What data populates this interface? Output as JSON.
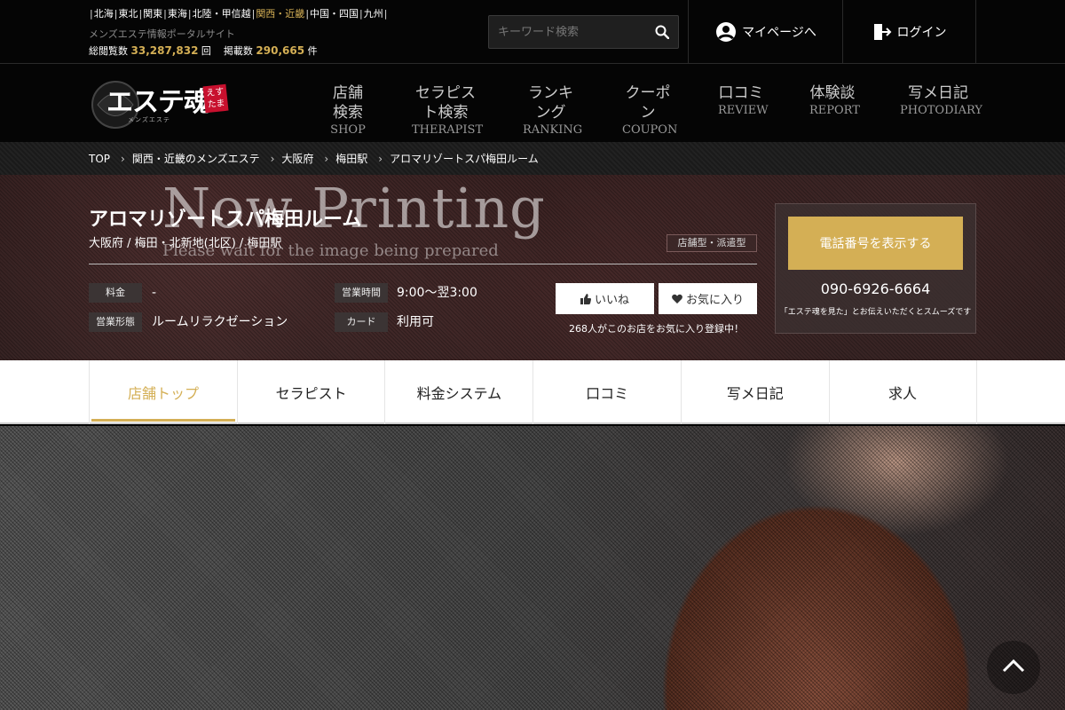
{
  "top": {
    "areas": [
      {
        "label": "北海",
        "active": false
      },
      {
        "label": "東北",
        "active": false
      },
      {
        "label": "関東",
        "active": false
      },
      {
        "label": "東海",
        "active": false
      },
      {
        "label": "北陸・甲信越",
        "active": false
      },
      {
        "label": "関西・近畿",
        "active": true
      },
      {
        "label": "中国・四国",
        "active": false
      },
      {
        "label": "九州",
        "active": false
      }
    ],
    "tagline": "メンズエステ情報ポータルサイト",
    "count1_label": "総閲覧数",
    "count1_value": "33,287,832",
    "count1_unit": "回",
    "count2_label": "掲載数",
    "count2_value": "290,665",
    "count2_unit": "件",
    "search_placeholder": "キーワード検索",
    "mypage_label": "マイページへ",
    "login_label": "ログイン"
  },
  "logo": {
    "text": "エステ魂",
    "badge": "えすたま",
    "sub": "メンズエステ"
  },
  "nav": [
    {
      "jp": "店舗検索",
      "en": "SHOP"
    },
    {
      "jp": "セラピスト検索",
      "en": "THERAPIST"
    },
    {
      "jp": "ランキング",
      "en": "RANKING"
    },
    {
      "jp": "クーポン",
      "en": "COUPON"
    },
    {
      "jp": "口コミ",
      "en": "REVIEW"
    },
    {
      "jp": "体験談",
      "en": "REPORT"
    },
    {
      "jp": "写メ日記",
      "en": "PHOTODIARY"
    }
  ],
  "breadcrumb": [
    "TOP",
    "関西・近畿のメンズエステ",
    "大阪府",
    "梅田駅",
    "アロマリゾートスパ梅田ルーム"
  ],
  "shop": {
    "name": "アロマリゾートスパ梅田ルーム",
    "area": "大阪府 / 梅田・北新地(北区) / 梅田駅",
    "tag": "店舗型・派遣型",
    "label_price": "料金",
    "value_price": "-",
    "label_hours": "営業時間",
    "value_hours": "9:00〜翌3:00",
    "label_type": "営業形態",
    "value_type": "ルームリラクゼーション",
    "label_card": "カード",
    "value_card": "利用可",
    "like_label": "いいね",
    "fav_label": "お気に入り",
    "fav_count": "268人がこのお店をお気に入り登録中！",
    "tel_button": "電話番号を表示する",
    "tel_number": "090-6926-6664",
    "tel_note": "「エステ魂を見た」とお伝えいただくとスムーズです"
  },
  "tabs": [
    {
      "label": "店舗トップ",
      "active": true
    },
    {
      "label": "セラピスト",
      "active": false
    },
    {
      "label": "料金システム",
      "active": false
    },
    {
      "label": "口コミ",
      "active": false
    },
    {
      "label": "写メ日記",
      "active": false
    },
    {
      "label": "求人",
      "active": false
    }
  ],
  "photo": {
    "title": "Now Printing",
    "subtitle": "Please wait for the image being prepared"
  }
}
